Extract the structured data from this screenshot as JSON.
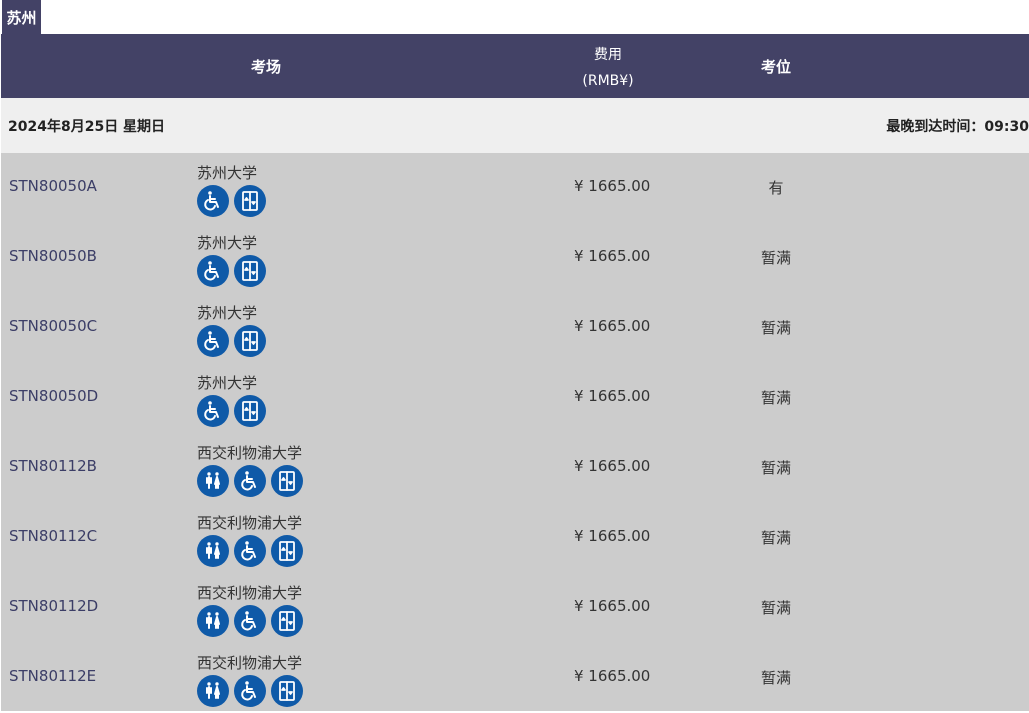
{
  "city_tab": "苏州",
  "header": {
    "venue": "考场",
    "fee_line1": "费用",
    "fee_line2": "(RMB¥)",
    "seat": "考位"
  },
  "date_row": {
    "date": "2024年8月25日 星期日",
    "arrival": "最晚到达时间：09:30"
  },
  "rows": [
    {
      "code": "STN80050A",
      "venue": "苏州大学",
      "icons": [
        "wheelchair-icon",
        "elevator-icon"
      ],
      "fee": "¥ 1665.00",
      "seat": "有"
    },
    {
      "code": "STN80050B",
      "venue": "苏州大学",
      "icons": [
        "wheelchair-icon",
        "elevator-icon"
      ],
      "fee": "¥ 1665.00",
      "seat": "暂满"
    },
    {
      "code": "STN80050C",
      "venue": "苏州大学",
      "icons": [
        "wheelchair-icon",
        "elevator-icon"
      ],
      "fee": "¥ 1665.00",
      "seat": "暂满"
    },
    {
      "code": "STN80050D",
      "venue": "苏州大学",
      "icons": [
        "wheelchair-icon",
        "elevator-icon"
      ],
      "fee": "¥ 1665.00",
      "seat": "暂满"
    },
    {
      "code": "STN80112B",
      "venue": "西交利物浦大学",
      "icons": [
        "restroom-icon",
        "wheelchair-icon",
        "elevator-icon"
      ],
      "fee": "¥ 1665.00",
      "seat": "暂满"
    },
    {
      "code": "STN80112C",
      "venue": "西交利物浦大学",
      "icons": [
        "restroom-icon",
        "wheelchair-icon",
        "elevator-icon"
      ],
      "fee": "¥ 1665.00",
      "seat": "暂满"
    },
    {
      "code": "STN80112D",
      "venue": "西交利物浦大学",
      "icons": [
        "restroom-icon",
        "wheelchair-icon",
        "elevator-icon"
      ],
      "fee": "¥ 1665.00",
      "seat": "暂满"
    },
    {
      "code": "STN80112E",
      "venue": "西交利物浦大学",
      "icons": [
        "restroom-icon",
        "wheelchair-icon",
        "elevator-icon"
      ],
      "fee": "¥ 1665.00",
      "seat": "暂满"
    }
  ],
  "colors": {
    "header_bg": "#434266",
    "icon_bg": "#0f5aa8",
    "row_bg": "#cccccc",
    "date_bg": "#efefef"
  }
}
